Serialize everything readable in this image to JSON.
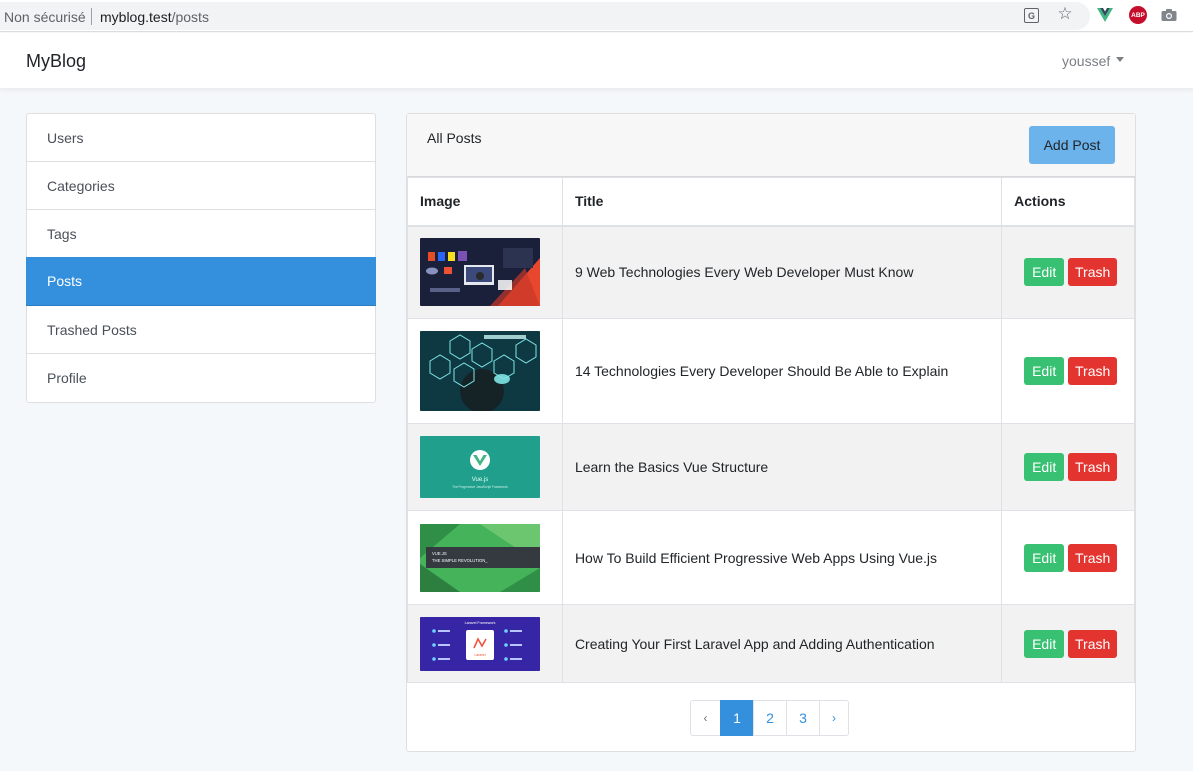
{
  "browser": {
    "security": "Non sécurisé",
    "url_host": "myblog.test",
    "url_path": "/posts",
    "icons": [
      "translate-icon",
      "star-icon",
      "vue-devtools-icon",
      "adblock-plus-icon",
      "camera-icon"
    ],
    "abp_label": "ABP"
  },
  "navbar": {
    "brand": "MyBlog",
    "user": "youssef"
  },
  "sidebar": {
    "items": [
      {
        "label": "Users"
      },
      {
        "label": "Categories"
      },
      {
        "label": "Tags"
      },
      {
        "label": "Posts",
        "active": true
      },
      {
        "label": "Trashed Posts"
      },
      {
        "label": "Profile"
      }
    ]
  },
  "card": {
    "title": "All Posts",
    "add_button": "Add Post",
    "columns": [
      "Image",
      "Title",
      "Actions"
    ],
    "posts": [
      {
        "title": "9 Web Technologies Every Web Developer Must Know",
        "edit": "Edit",
        "trash": "Trash"
      },
      {
        "title": "14 Technologies Every Developer Should Be Able to Explain",
        "edit": "Edit",
        "trash": "Trash"
      },
      {
        "title": "Learn the Basics Vue Structure",
        "edit": "Edit",
        "trash": "Trash"
      },
      {
        "title": "How To Build Efficient Progressive Web Apps Using Vue.js",
        "edit": "Edit",
        "trash": "Trash"
      },
      {
        "title": "Creating Your First Laravel App and Adding Authentication",
        "edit": "Edit",
        "trash": "Trash"
      }
    ],
    "thumb_texts": {
      "vue_logo": "Vue.js",
      "vue_sub": "The Progressive JavaScript Framework",
      "pwa_line1": "VUE.JS",
      "pwa_line2": "THE SIMPLE REVOLUTION_",
      "laravel_title": "Laravel Framework",
      "laravel_name": "Laravel"
    }
  },
  "pagination": {
    "prev": "‹",
    "pages": [
      "1",
      "2",
      "3"
    ],
    "current": "1",
    "next": "›"
  },
  "colors": {
    "primary": "#3490dc",
    "info": "#6cb2eb",
    "success": "#38c172",
    "danger": "#e3342f"
  }
}
